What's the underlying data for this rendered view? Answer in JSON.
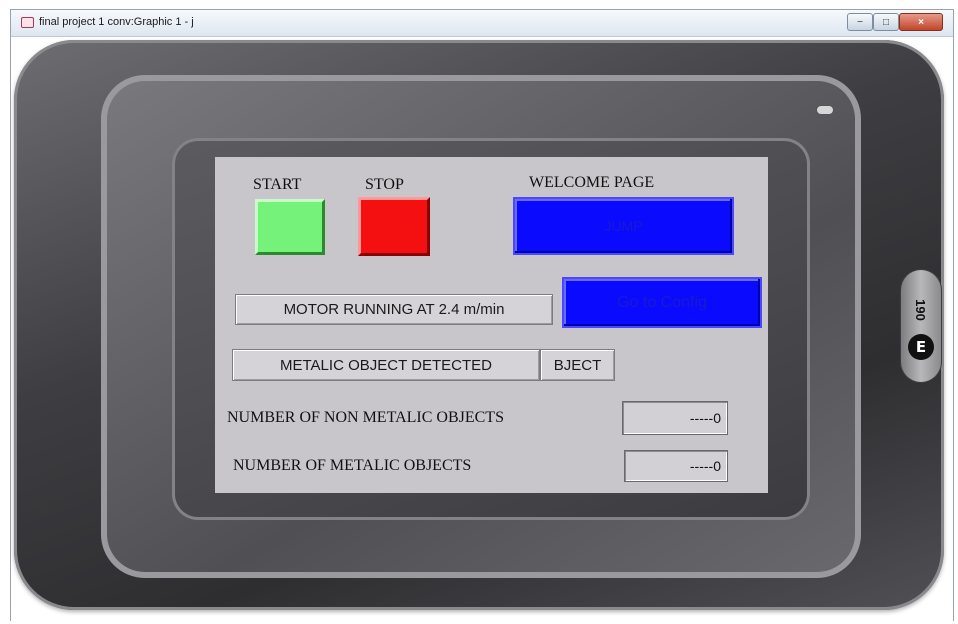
{
  "window": {
    "title": "final project 1 conv:Graphic 1 - j",
    "controls": {
      "minimize": "−",
      "maximize": "□",
      "close": "×"
    }
  },
  "device": {
    "model_label": "190",
    "logo_letter": "E"
  },
  "screen": {
    "start_label": "START",
    "stop_label": "STOP",
    "welcome_label": "WELCOME PAGE",
    "jump_button": "JUMP",
    "config_button": "Go to Config",
    "motor_status": "MOTOR RUNNING AT 2.4 m/min",
    "metal_status": "METALIC OBJECT DETECTED",
    "object_status_partial": "BJECT",
    "non_metal_count_label": "NUMBER OF NON METALIC OBJECTS",
    "non_metal_count_value": "-----0",
    "metal_count_label": "NUMBER OF METALIC OBJECTS",
    "metal_count_value": "-----0"
  },
  "colors": {
    "start_button": "#74f27a",
    "stop_button": "#f41010",
    "nav_button": "#0a0aff",
    "screen_bg": "#c9c6cb"
  }
}
